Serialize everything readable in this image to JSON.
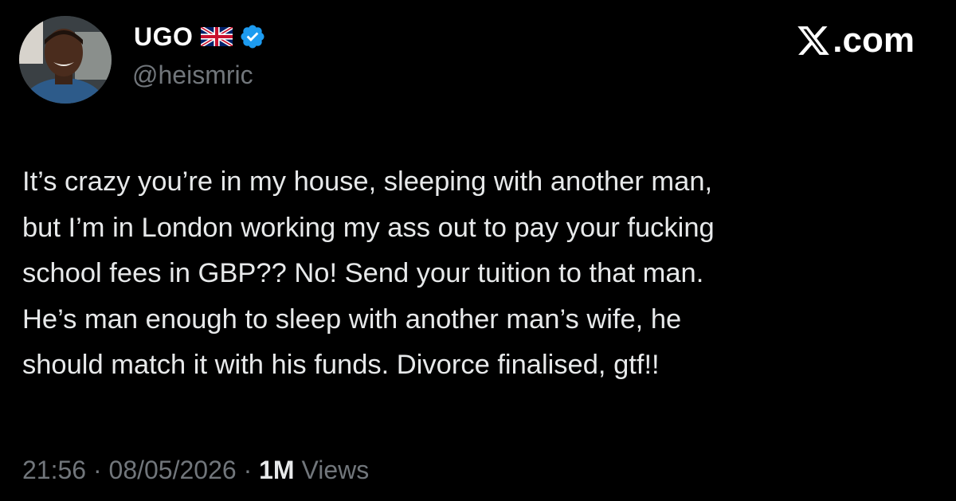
{
  "author": {
    "display_name": "UGO",
    "handle": "@heismric",
    "flag_icon": "uk-flag-icon",
    "verified_icon": "verified-badge-icon",
    "verified_color": "#1d9bf0"
  },
  "brand": {
    "logo_icon": "x-logo-icon",
    "text": ".com"
  },
  "tweet": {
    "text": "It’s crazy you’re in my house, sleeping with another man,\nbut I’m in London working my ass out to pay your fucking\nschool fees in GBP?? No! Send your tuition to that man.\nHe’s man enough to sleep with another man’s wife, he\nshould match it with his funds. Divorce finalised, gtf!!"
  },
  "meta": {
    "time": "21:56",
    "separator": " · ",
    "date": "08/05/2026",
    "views_count": "1M",
    "views_label": " Views"
  },
  "colors": {
    "background": "#000000",
    "primary_text": "#e7e9ea",
    "secondary_text": "#71767b"
  }
}
